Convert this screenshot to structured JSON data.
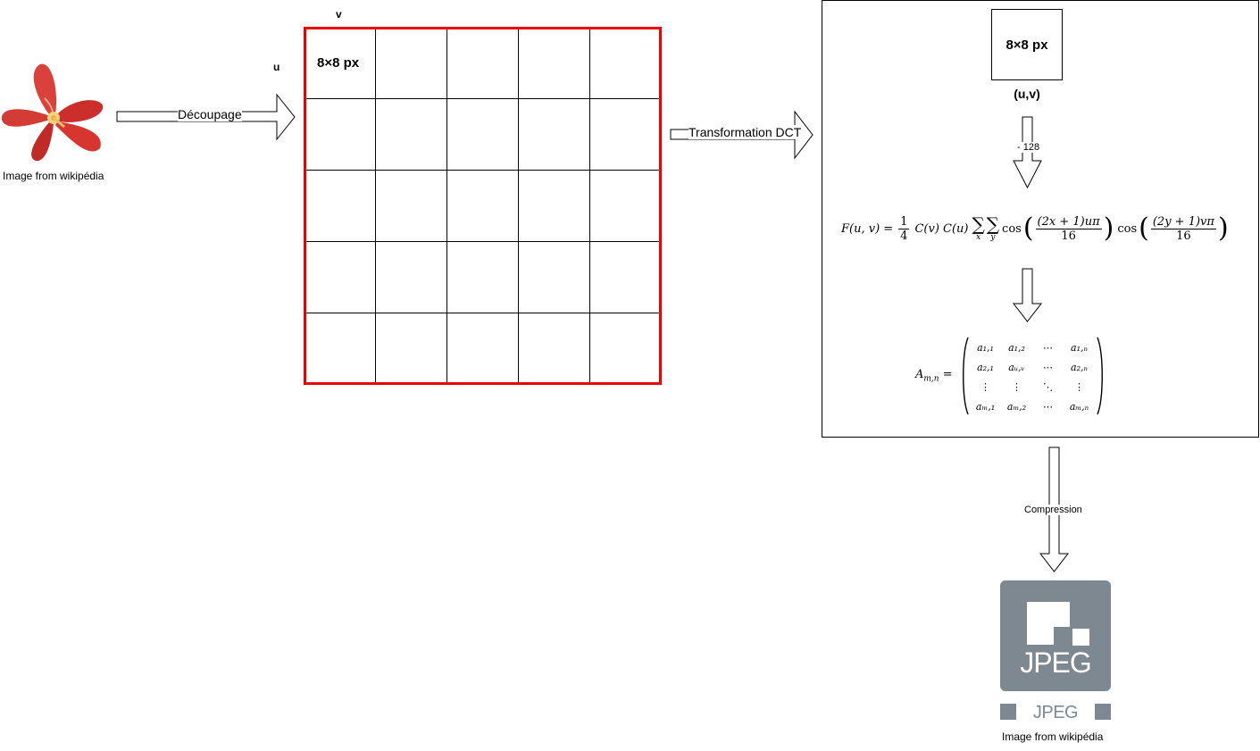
{
  "source_image": {
    "caption": "Image from wikipédia",
    "icon": "flower-photo"
  },
  "arrow_decoupage": {
    "label": "Découpage"
  },
  "grid": {
    "axis_u": "u",
    "axis_v": "v",
    "block_label": "8×8 px",
    "rows": 5,
    "cols": 5,
    "border_color": "#ee0000"
  },
  "arrow_dct": {
    "label": "Transformation DCT"
  },
  "dct_panel": {
    "block_label": "8×8 px",
    "coord_label": "(u,v)",
    "shift_label": "- 128",
    "formula_lhs": "F(u, v) =",
    "formula_frac_num": "1",
    "formula_frac_den": "4",
    "formula_c": "C(v) C(u)",
    "formula_sum_x": "x",
    "formula_sum_y": "y",
    "formula_cos": "cos",
    "formula_num1": "(2x + 1)uπ",
    "formula_num2": "(2y + 1)vπ",
    "formula_den": "16",
    "matrix_lhs": "A",
    "matrix_lhs_sub": "m,n",
    "matrix_eq": "=",
    "matrix_cells": [
      [
        "a₁,₁",
        "a₁,₂",
        "⋯",
        "a₁,ₙ"
      ],
      [
        "a₂,₁",
        "aᵤ,ᵥ",
        "⋯",
        "a₂,ₙ"
      ],
      [
        "⋮",
        "⋮",
        "⋱",
        "⋮"
      ],
      [
        "aₘ,₁",
        "aₘ,₂",
        "⋯",
        "aₘ,ₙ"
      ]
    ]
  },
  "arrow_compression": {
    "label": "Compression"
  },
  "jpeg_logo": {
    "logo_text": "JPEG",
    "wordmark": "JPEG",
    "caption": "Image from wikipédia",
    "color": "#7d8891"
  }
}
